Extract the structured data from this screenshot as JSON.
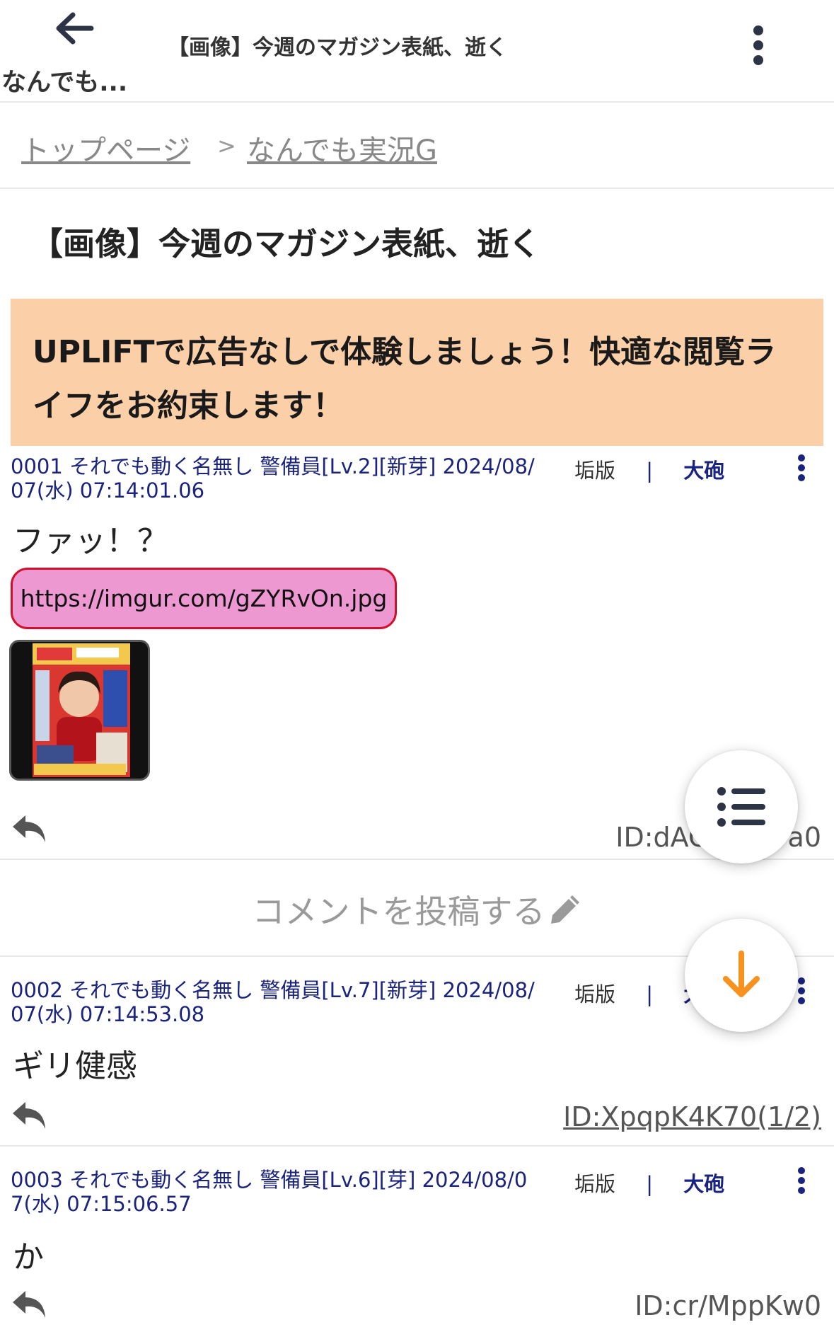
{
  "appbar": {
    "back_label": "なんでも...",
    "title": "【画像】今週のマガジン表紙、逝く"
  },
  "breadcrumb": {
    "home": "トップページ",
    "separator": ">",
    "board": "なんでも実況G"
  },
  "thread": {
    "title": "【画像】今週のマガジン表紙、逝く"
  },
  "promo": {
    "text": "UPLIFTで広告なしで体験しましょう！快適な閲覧ライフをお約束します！"
  },
  "posts": [
    {
      "header_line1": "0001 それでも動く名無し 警備員[Lv.2][新芽] 2024/08/",
      "header_line2": "07(水) 07:14:01.06",
      "kai": "垢版",
      "pipe": "|",
      "taiho": "大砲",
      "body": "ファッ！？",
      "link": "https://imgur.com/gZYRvOn.jpg",
      "id": "ID:dAC　　　a0"
    },
    {
      "header_line1": "0002 それでも動く名無し 警備員[Lv.7][新芽] 2024/08/",
      "header_line2": "07(水) 07:14:53.08",
      "kai": "垢版",
      "pipe": "|",
      "taiho": "大",
      "body": "ギリ健感",
      "id": "ID:XpqpK4K70(1/2)"
    },
    {
      "header_line1": "0003 それでも動く名無し 警備員[Lv.6][芽] 2024/08/0",
      "header_line2": "7(水) 07:15:06.57",
      "kai": "垢版",
      "pipe": "|",
      "taiho": "大砲",
      "body": "か",
      "id": "ID:cr/MppKw0"
    }
  ],
  "comment_button": {
    "label": "コメントを投稿する"
  },
  "colors": {
    "header_blue": "#1a237e",
    "promo_bg": "#fbd0a9",
    "link_pill_bg": "#ee98d1",
    "link_pill_border": "#d10f2d",
    "fab_arrow": "#f7921e",
    "icon_dark": "#2d3446"
  },
  "icons": {
    "back": "arrow-left-icon",
    "more": "vertical-ellipsis-icon",
    "reply": "reply-arrow-icon",
    "edit": "pencil-icon",
    "list": "list-icon",
    "scroll_down": "arrow-down-icon"
  }
}
